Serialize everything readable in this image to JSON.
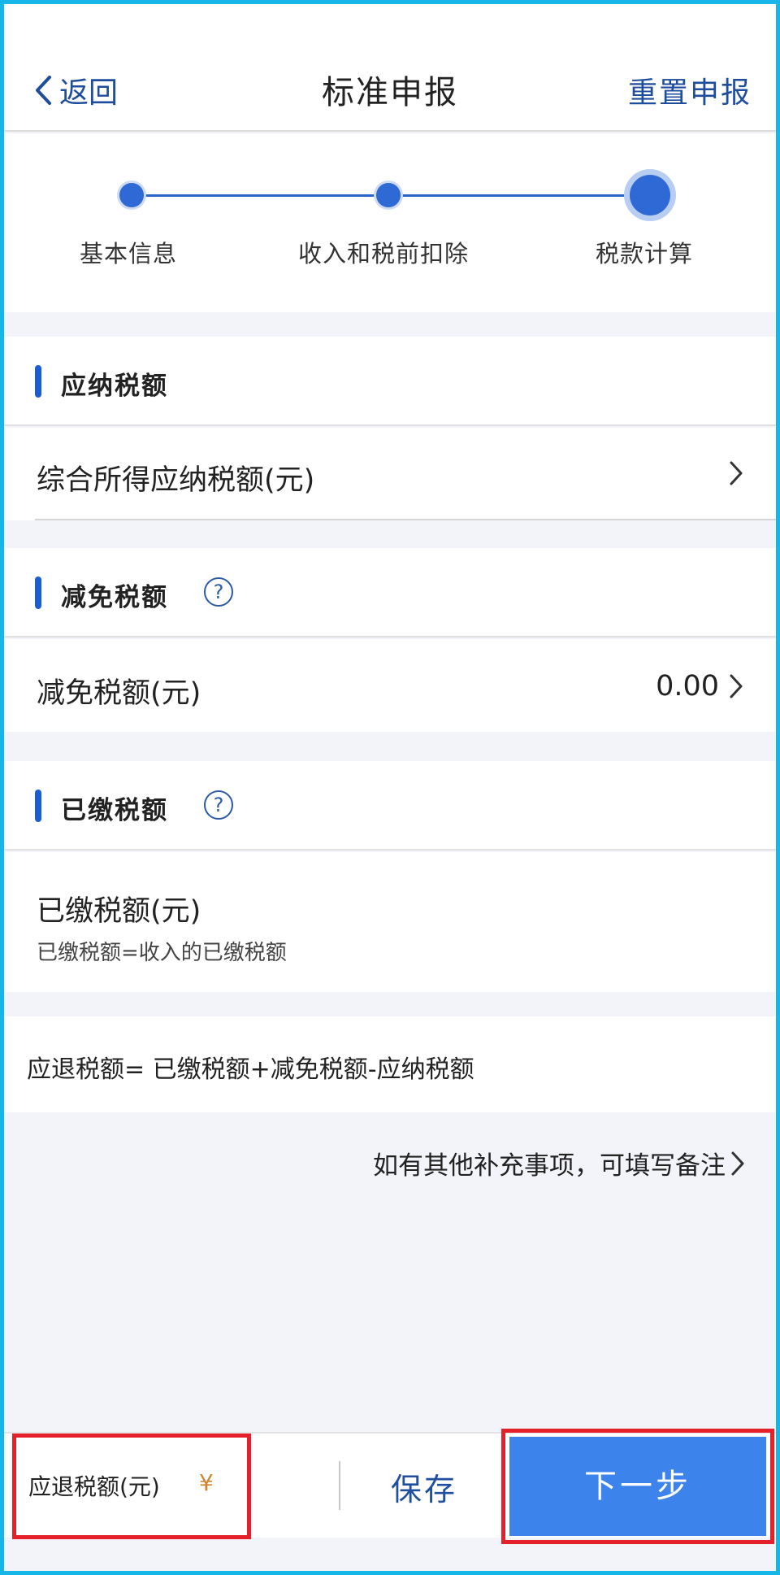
{
  "header": {
    "back_label": "返回",
    "title": "标准申报",
    "reset_label": "重置申报"
  },
  "stepper": {
    "steps": [
      {
        "label": "基本信息"
      },
      {
        "label": "收入和税前扣除"
      },
      {
        "label": "税款计算"
      }
    ],
    "current_step": 3
  },
  "sections": {
    "payable": {
      "title": "应纳税额",
      "row_label": "综合所得应纳税额(元)"
    },
    "exemption": {
      "title": "减免税额",
      "help_icon": "?",
      "row_label": "减免税额(元)",
      "row_value": "0.00"
    },
    "paid": {
      "title": "已缴税额",
      "help_icon": "?",
      "row_label": "已缴税额(元)",
      "row_sub": "已缴税额=收入的已缴税额"
    }
  },
  "formula": "应退税额= 已缴税额+减免税额-应纳税额",
  "remark_link": "如有其他补充事项，可填写备注",
  "bottom_bar": {
    "refund_label": "应退税额(元)",
    "refund_currency": "¥",
    "save_label": "保存",
    "next_label": "下一步"
  },
  "colors": {
    "brand_blue": "#1c5ed2",
    "next_button": "#3d83ec",
    "highlight_red": "#e5202b",
    "currency": "#d2822a"
  }
}
